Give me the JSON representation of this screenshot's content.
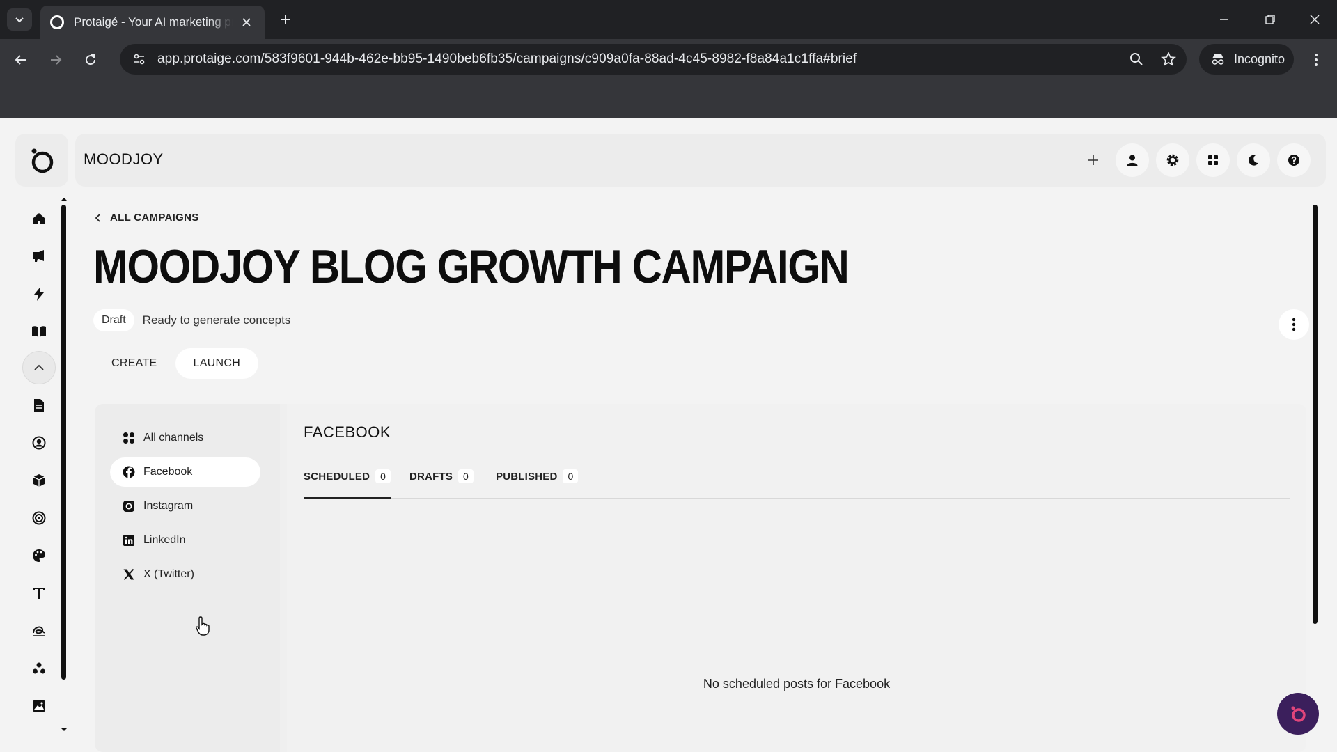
{
  "browser": {
    "tab_title": "Protaigé - Your AI marketing pr",
    "url": "app.protaige.com/583f9601-944b-462e-bb95-1490beb6fb35/campaigns/c909a0fa-88ad-4c45-8982-f8a84a1c1ffa#brief",
    "incognito_label": "Incognito"
  },
  "header": {
    "brand": "MOODJOY"
  },
  "page": {
    "back_label": "ALL CAMPAIGNS",
    "title": "MOODJOY BLOG GROWTH CAMPAIGN",
    "status_badge": "Draft",
    "status_text": "Ready to generate concepts",
    "tabs": [
      {
        "label": "CREATE",
        "active": false
      },
      {
        "label": "LAUNCH",
        "active": true
      }
    ]
  },
  "channels": {
    "items": [
      {
        "label": "All channels",
        "icon": "grid-icon"
      },
      {
        "label": "Facebook",
        "icon": "facebook-icon",
        "active": true
      },
      {
        "label": "Instagram",
        "icon": "instagram-icon"
      },
      {
        "label": "LinkedIn",
        "icon": "linkedin-icon"
      },
      {
        "label": "X (Twitter)",
        "icon": "x-twitter-icon"
      }
    ]
  },
  "content": {
    "title": "FACEBOOK",
    "subtabs": [
      {
        "label": "SCHEDULED",
        "count": "0",
        "active": true
      },
      {
        "label": "DRAFTS",
        "count": "0"
      },
      {
        "label": "PUBLISHED",
        "count": "0"
      }
    ],
    "empty_message": "No scheduled posts for Facebook"
  },
  "sidebar_icons": [
    "home-icon",
    "megaphone-icon",
    "lightning-icon",
    "book-icon",
    "chevron-up-icon",
    "document-icon",
    "user-circle-icon",
    "cube-icon",
    "target-icon",
    "palette-icon",
    "text-icon",
    "signature-icon",
    "people-icon",
    "image-icon"
  ],
  "colors": {
    "chrome_dark": "#202124",
    "chrome_mid": "#35363a",
    "app_bg": "#f3f3f3",
    "fab": "#3b1f5c",
    "fab_ring": "#e0457b"
  }
}
